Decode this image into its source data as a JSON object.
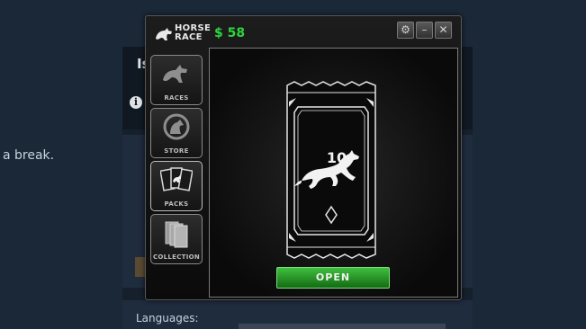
{
  "background_page": {
    "header_title": "Is",
    "side_text": "a break.",
    "languages_label": "Languages:"
  },
  "window": {
    "app_name_line1": "HORSE",
    "app_name_line2": "RACE",
    "money": "$ 58",
    "controls": [
      "gear-icon",
      "minimize-icon",
      "close-icon"
    ]
  },
  "sidebar": {
    "items": [
      {
        "label": "RACES",
        "icon": "horse-icon"
      },
      {
        "label": "STORE",
        "icon": "store-horse-badge-icon"
      },
      {
        "label": "PACKS",
        "icon": "packs-icon"
      },
      {
        "label": "COLLECTION",
        "icon": "collection-icon"
      }
    ]
  },
  "pack": {
    "count": "10",
    "icon": "running-horse-icon",
    "open_label": "OPEN"
  },
  "colors": {
    "money": "#2fd43c",
    "open_button": "#2a9a2a",
    "page_bg": "#1b2838"
  }
}
